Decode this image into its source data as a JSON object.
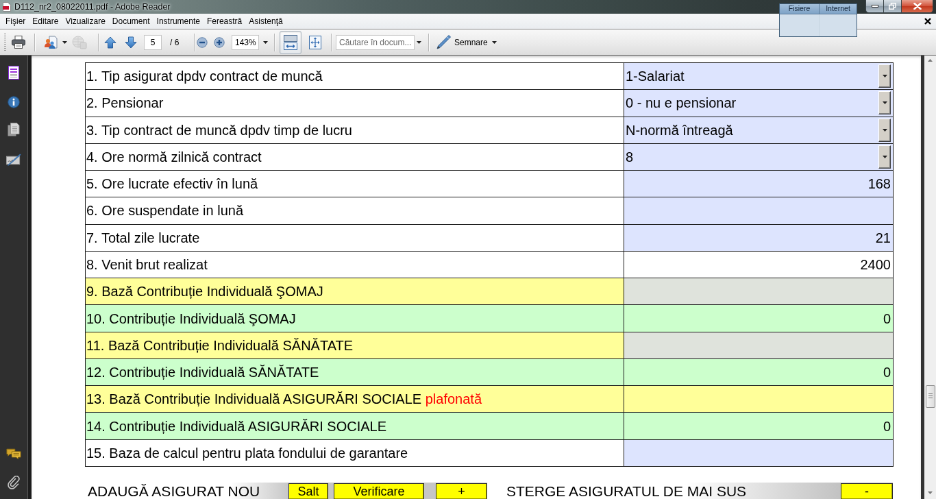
{
  "window": {
    "title": "D112_nr2_08022011.pdf - Adobe Reader"
  },
  "floating_panel": {
    "columns": [
      "Fisiere",
      "Internet"
    ]
  },
  "menu": [
    "Fişier",
    "Editare",
    "Vizualizare",
    "Document",
    "Instrumente",
    "Fereastră",
    "Asistenţă"
  ],
  "toolbar": {
    "tool_buttons": [
      {
        "kind": "print",
        "dropdown": false,
        "disabled": false
      },
      {
        "kind": "people",
        "dropdown": true,
        "disabled": false
      },
      {
        "kind": "globe",
        "dropdown": false,
        "disabled": true
      }
    ],
    "page": {
      "value": "5",
      "total": "/ 6"
    },
    "zoom": {
      "value": "143%"
    },
    "view_buttons": [
      {
        "kind": "fit-width",
        "selected": true
      },
      {
        "kind": "fit-page",
        "selected": false
      }
    ],
    "search": {
      "placeholder": "Căutare în docum..."
    },
    "sign_button": {
      "label": "Semnare"
    }
  },
  "form_rows": [
    {
      "label": {
        "text": "1. Tip asigurat dpdv contract de muncă",
        "color": "#ffffff"
      },
      "field": {
        "kind": "dropdown",
        "value": "1-Salariat",
        "color": "#dde4fe"
      }
    },
    {
      "label": {
        "text": "2. Pensionar",
        "color": "#ffffff"
      },
      "field": {
        "kind": "dropdown",
        "value": "0 - nu e pensionar",
        "color": "#dde4fe"
      }
    },
    {
      "label": {
        "text": "3. Tip contract de muncă dpdv timp de lucru",
        "color": "#ffffff"
      },
      "field": {
        "kind": "dropdown",
        "value": "N-normă întreagă",
        "color": "#dde4fe"
      }
    },
    {
      "label": {
        "text": "4. Ore normă zilnică contract",
        "color": "#ffffff"
      },
      "field": {
        "kind": "dropdown",
        "value": "8",
        "color": "#dde4fe"
      }
    },
    {
      "label": {
        "text": "5. Ore lucrate efectiv în lună",
        "color": "#ffffff"
      },
      "field": {
        "kind": "number",
        "value": "168",
        "color": "#dde4fe"
      }
    },
    {
      "label": {
        "text": "6. Ore suspendate in lună",
        "color": "#ffffff"
      },
      "field": {
        "kind": "number",
        "color": "#dde4fe"
      }
    },
    {
      "label": {
        "text": "7. Total zile lucrate",
        "color": "#ffffff"
      },
      "field": {
        "kind": "number",
        "value": "21",
        "color": "#dde4fe"
      }
    },
    {
      "label": {
        "text": "8. Venit brut realizat",
        "color": "#ffffff"
      },
      "field": {
        "kind": "number",
        "value": "2400",
        "color": "#ffffff"
      }
    },
    {
      "label": {
        "text": "9. Bază Contribuție Individuală ŞOMAJ",
        "color": "#ffff99"
      },
      "field": {
        "kind": "number",
        "color": "#dfe3dc"
      }
    },
    {
      "label": {
        "text": "10. Contribuție Individuală ŞOMAJ",
        "color": "#ccffcc"
      },
      "field": {
        "kind": "number",
        "value": "0",
        "color": "#ccffcc"
      }
    },
    {
      "label": {
        "text": "11. Bază Contribuție Individuală SĂNĂTATE",
        "color": "#ffff99"
      },
      "field": {
        "kind": "number",
        "color": "#dfe3dc"
      }
    },
    {
      "label": {
        "text": "12. Contribuție Individuală SĂNĂTATE",
        "color": "#ccffcc"
      },
      "field": {
        "kind": "number",
        "value": "0",
        "color": "#ccffcc"
      }
    },
    {
      "label": {
        "text": "13. Bază Contribuție Individuală ASIGURĂRI SOCIALE",
        "note": "plafonată",
        "color": "#ffff99"
      },
      "field": {
        "kind": "number",
        "color": "#ffff99"
      }
    },
    {
      "label": {
        "text": "14. Contribuție Individuală ASIGURĂRI SOCIALE",
        "color": "#ccffcc"
      },
      "field": {
        "kind": "number",
        "value": "0",
        "color": "#ccffcc"
      }
    },
    {
      "label": {
        "text": "15. Baza de calcul pentru plata fondului de garantare",
        "color": "#ffffff"
      },
      "field": {
        "kind": "number",
        "color": "#dde4fe"
      }
    }
  ],
  "actions": [
    {
      "label": "ADAUGĂ ASIGURAT NOU",
      "buttons": [
        "Salt",
        "Verificare",
        "+"
      ]
    },
    {
      "label": "STERGE ASIGURATUL DE MAI SUS",
      "buttons": [
        "-"
      ]
    }
  ]
}
